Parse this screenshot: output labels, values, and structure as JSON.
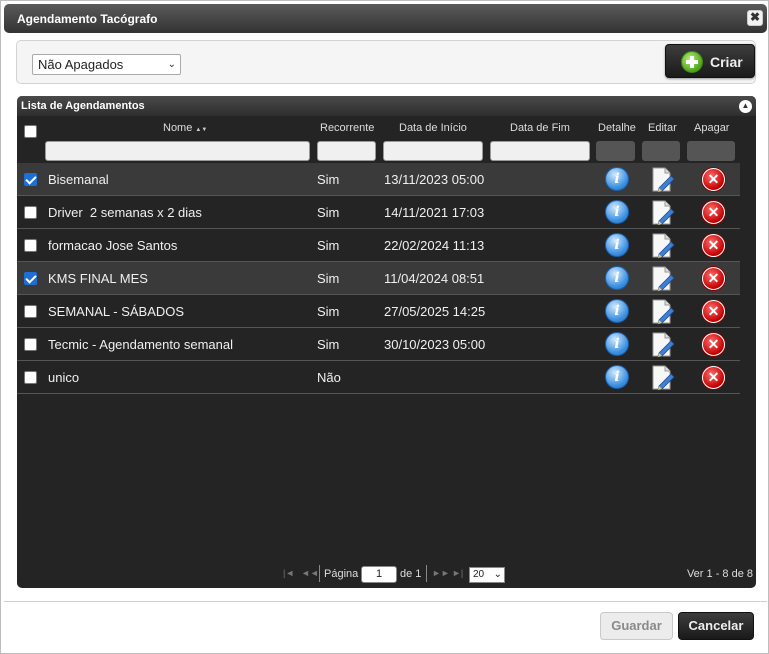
{
  "dialog": {
    "title": "Agendamento Tacógrafo",
    "close_glyph": "✖"
  },
  "toolbar": {
    "filter_value": "Não Apagados",
    "create_label": "Criar"
  },
  "grid": {
    "caption": "Lista de Agendamentos",
    "collapse_glyph": "▲",
    "columns": {
      "nome": "Nome",
      "recorrente": "Recorrente",
      "data_inicio": "Data de Início",
      "data_fim": "Data de Fim",
      "detalhe": "Detalhe",
      "editar": "Editar",
      "apagar": "Apagar"
    },
    "sort_glyph": "▲▼",
    "rows": [
      {
        "checked": true,
        "nome": "Bisemanal",
        "recorrente": "Sim",
        "data_inicio": "13/11/2023 05:00",
        "data_fim": ""
      },
      {
        "checked": false,
        "nome": "Driver  2 semanas x 2 dias",
        "recorrente": "Sim",
        "data_inicio": "14/11/2021 17:03",
        "data_fim": ""
      },
      {
        "checked": false,
        "nome": "formacao Jose Santos",
        "recorrente": "Sim",
        "data_inicio": "22/02/2024 11:13",
        "data_fim": ""
      },
      {
        "checked": true,
        "nome": "KMS FINAL MES",
        "recorrente": "Sim",
        "data_inicio": "11/04/2024 08:51",
        "data_fim": ""
      },
      {
        "checked": false,
        "nome": "SEMANAL - SÁBADOS",
        "recorrente": "Sim",
        "data_inicio": "27/05/2025 14:25",
        "data_fim": ""
      },
      {
        "checked": false,
        "nome": "Tecmic - Agendamento semanal",
        "recorrente": "Sim",
        "data_inicio": "30/10/2023 05:00",
        "data_fim": ""
      },
      {
        "checked": false,
        "nome": "unico",
        "recorrente": "Não",
        "data_inicio": "",
        "data_fim": ""
      }
    ],
    "icons": {
      "detail": "info-icon",
      "edit": "edit-document-icon",
      "delete": "delete-x-icon"
    }
  },
  "pager": {
    "first": "|◄",
    "prev": "◄◄",
    "next": "►►",
    "last": "►|",
    "page_label": "Página",
    "page_value": "1",
    "of_label": "de 1",
    "rows_per_page": "20",
    "records": "Ver 1 - 8 de 8"
  },
  "footer": {
    "save_label": "Guardar",
    "cancel_label": "Cancelar"
  },
  "colors": {
    "accent_blue": "#1d6fd6",
    "grid_bg": "#242424",
    "delete_red": "#c20000",
    "add_green": "#4fa31a"
  }
}
